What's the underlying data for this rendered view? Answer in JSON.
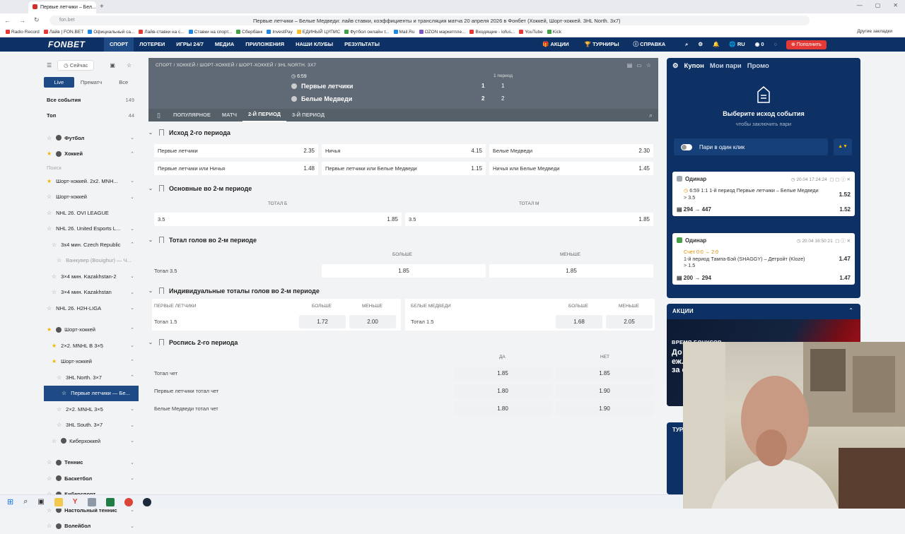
{
  "browser": {
    "tab_title": "Первые летчики – Бел...",
    "new_tab": "+",
    "url": "fon.bet",
    "page_title": "Первые летчики – Белые Медведи: лайв ставки, коэффициенты и трансляция матча 20 апреля 2026 в Фонбет (Хоккей, Шорт-хоккей. 3HL North. 3x7)",
    "bookmarks": [
      "Radio Record",
      "Лайв | FON.BET",
      "Официальный са...",
      "Лайв-ставки на с...",
      "Ставки на спорт...",
      "Сбербанк",
      "InvestPay",
      "ЕДИНЫЙ ЦУПИС",
      "Футбол онлайн т...",
      "Mail.Ru",
      "OZON маркетпле...",
      "Входящие - lofus...",
      "YouTube",
      "Kick"
    ],
    "bookmarks_right": "Другие закладки"
  },
  "site": {
    "logo": "FONBET",
    "nav": [
      "СПОРТ",
      "ЛОТЕРЕИ",
      "ИГРЫ 24/7",
      "МЕДИА",
      "ПРИЛОЖЕНИЯ",
      "НАШИ КЛУБЫ",
      "РЕЗУЛЬТАТЫ"
    ],
    "right_nav": {
      "promos": "АКЦИИ",
      "tournaments": "ТУРНИРЫ",
      "help": "СПРАВКА",
      "lang": "RU",
      "balance": "0",
      "deposit": "Пополнить"
    }
  },
  "sidebar": {
    "now": "Сейчас",
    "tabs": [
      "Live",
      "Прематч",
      "Все"
    ],
    "all_events": {
      "label": "Все события",
      "count": "149"
    },
    "top": {
      "label": "Топ",
      "count": "44"
    },
    "search": "Поиск",
    "items": [
      {
        "label": "Футбол"
      },
      {
        "label": "Хоккей"
      },
      {
        "label": "Шорт-хоккей. 2x2. MNH..."
      },
      {
        "label": "Шорт-хоккей"
      },
      {
        "label": "NHL 26. OVI LEAGUE"
      },
      {
        "label": "NHL 26. United Esports L..."
      },
      {
        "label": "3x4 мин. Czech Republic"
      },
      {
        "label": "Ванкувер (Bouighur) — Ч..."
      },
      {
        "label": "3×4 мин. Kazakhstan-2"
      },
      {
        "label": "3×4 мин. Kazakhstan"
      },
      {
        "label": "NHL 26. H2H-LIGA"
      },
      {
        "label": "Шорт-хоккей"
      },
      {
        "label": "2×2. MNHL В 3×5"
      },
      {
        "label": "Шорт-хоккей"
      },
      {
        "label": "3HL North. 3×7"
      },
      {
        "label": "Первые летчики — Бе..."
      },
      {
        "label": "2×2. MNHL 3×5"
      },
      {
        "label": "3HL South. 3×7"
      },
      {
        "label": "Киберхоккей"
      },
      {
        "label": "Теннис"
      },
      {
        "label": "Баскетбол"
      },
      {
        "label": "Киберспорт"
      },
      {
        "label": "Настольный теннис"
      },
      {
        "label": "Волейбол"
      }
    ]
  },
  "event": {
    "breadcrumb": "СПОРТ / ХОККЕЙ / ШОРТ-ХОККЕЙ / ШОРТ-ХОККЕЙ / 3HL NORTH. 3X7",
    "time": "6:59",
    "period_label": "1 период",
    "team1": {
      "name": "Первые летчики",
      "score": "1",
      "p1": "1"
    },
    "team2": {
      "name": "Белые Медведи",
      "score": "2",
      "p1": "2"
    },
    "tabs": [
      "ПОПУЛЯРНОЕ",
      "МАТЧ",
      "2-Й ПЕРИОД",
      "3-Й ПЕРИОД"
    ]
  },
  "markets": {
    "m1": {
      "title": "Исход 2-го периода",
      "r1": [
        {
          "l": "Первые летчики",
          "v": "2.35"
        },
        {
          "l": "Ничья",
          "v": "4.15"
        },
        {
          "l": "Белые Медведи",
          "v": "2.30"
        }
      ],
      "r2": [
        {
          "l": "Первые летчики или Ничья",
          "v": "1.48"
        },
        {
          "l": "Первые летчики или Белые Медведи",
          "v": "1.15"
        },
        {
          "l": "Ничья или Белые Медведи",
          "v": "1.45"
        }
      ]
    },
    "m2": {
      "title": "Основные во 2-м периоде",
      "h1": "ТОТАЛ Б",
      "h2": "ТОТАЛ М",
      "c1": {
        "l": "3.5",
        "v": "1.85"
      },
      "c2": {
        "l": "3.5",
        "v": "1.85"
      }
    },
    "m3": {
      "title": "Тотал голов во 2-м периоде",
      "h1": "БОЛЬШЕ",
      "h2": "МЕНЬШЕ",
      "row": "Тотал 3.5",
      "v1": "1.85",
      "v2": "1.85"
    },
    "m4": {
      "title": "Индивидуальные тоталы голов во 2-м периоде",
      "t1": "ПЕРВЫЕ ЛЕТЧИКИ",
      "t2": "БЕЛЫЕ МЕДВЕДИ",
      "more": "БОЛЬШЕ",
      "less": "МЕНЬШЕ",
      "r1": "Тотал 1.5",
      "a1": "1.72",
      "a2": "2.00",
      "r2": "Тотал 1.5",
      "b1": "1.68",
      "b2": "2.05"
    },
    "m5": {
      "title": "Роспись 2-го периода",
      "h1": "ДА",
      "h2": "НЕТ",
      "rows": [
        {
          "l": "Тотал чет",
          "y": "1.85",
          "n": "1.85"
        },
        {
          "l": "Первые летчики тотал чет",
          "y": "1.80",
          "n": "1.90"
        },
        {
          "l": "Белые Медведи тотал чет",
          "y": "1.80",
          "n": "1.90"
        }
      ]
    }
  },
  "coupon": {
    "tabs": [
      "Купон",
      "Мои пари",
      "Промо"
    ],
    "empty_title": "Выберите исход события",
    "empty_sub": "чтобы заключить пари",
    "one_click": "Пари в один клик",
    "bet1": {
      "type": "Одинар",
      "date": "20.04  17:24:24",
      "time": "6:59",
      "desc": "1:1 1-й период Первые летчики – Белые Медведи",
      "line": "> 3.5",
      "odd": "1.52",
      "stake": "294",
      "win": "447",
      "odd2": "1.52"
    },
    "bet2": {
      "type": "Одинар",
      "date": "20.04  16:50:21",
      "score": "Счет 0:0 → 2:0",
      "desc": "1-й период Тампа-Бэй (SHAGGY) – Детройт (Kloze)",
      "line": "> 1.5",
      "odd": "1.47",
      "stake": "200",
      "win": "294",
      "odd2": "1.47"
    }
  },
  "promo": {
    "header": "АКЦИИ",
    "t1": "ВРЕМЯ БОНУСОВ",
    "t2": "До 100 000 ₽",
    "t3": "еж...",
    "t4": "за с..."
  },
  "tournaments": {
    "header": "ТУР..."
  },
  "colors": {
    "brand": "#0d3164",
    "active": "#1e4a85",
    "deposit": "#e53935",
    "star": "#f5b400"
  }
}
